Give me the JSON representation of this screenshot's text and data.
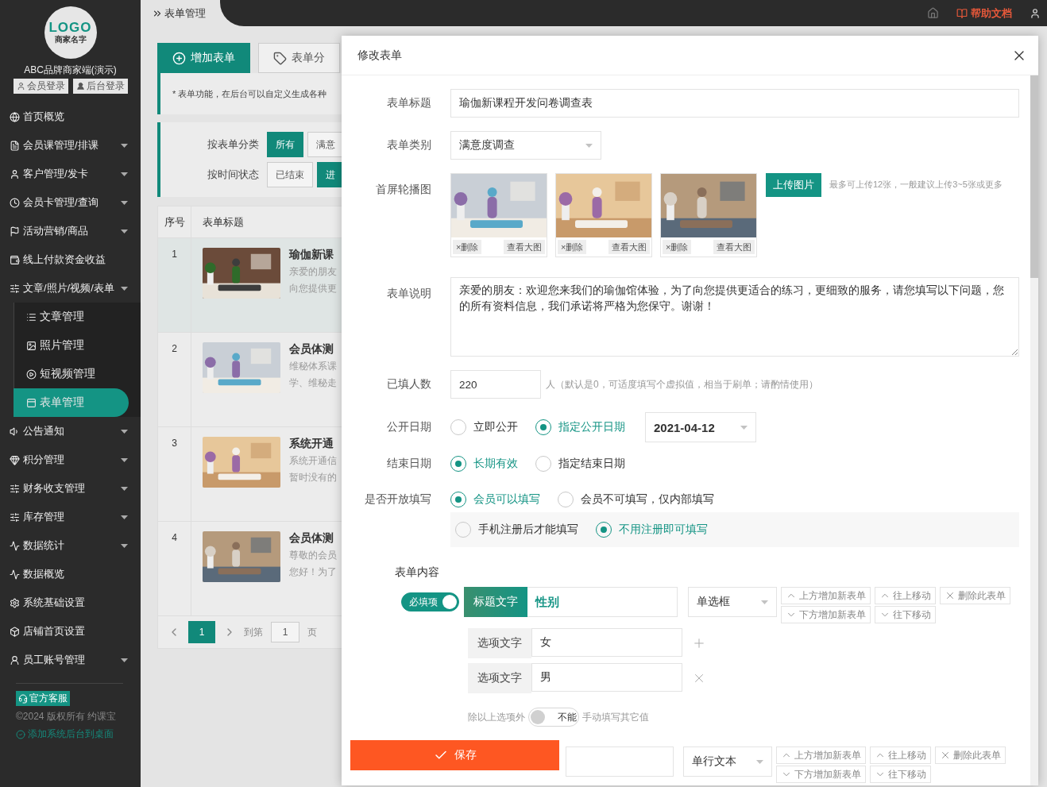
{
  "sidebar": {
    "logo": {
      "mark": "LOGO",
      "name": "商家名字"
    },
    "brand": "ABC品牌商家端(演示)",
    "login_buttons": [
      "会员登录",
      "后台登录"
    ],
    "menu": [
      {
        "label": "首页概览",
        "submenu": false
      },
      {
        "label": "会员课管理/排课",
        "submenu": true
      },
      {
        "label": "客户管理/发卡",
        "submenu": true
      },
      {
        "label": "会员卡管理/查询",
        "submenu": true
      },
      {
        "label": "活动营销/商品",
        "submenu": true
      },
      {
        "label": "线上付款资金收益",
        "submenu": false
      },
      {
        "label": "文章/照片/视频/表单",
        "submenu": true,
        "children": [
          {
            "label": "文章管理",
            "selected": false
          },
          {
            "label": "照片管理",
            "selected": false
          },
          {
            "label": "短视频管理",
            "selected": false
          },
          {
            "label": "表单管理",
            "selected": true
          }
        ]
      },
      {
        "label": "公告通知",
        "submenu": true
      },
      {
        "label": "积分管理",
        "submenu": true
      },
      {
        "label": "财务收支管理",
        "submenu": true
      },
      {
        "label": "库存管理",
        "submenu": true
      },
      {
        "label": "数据统计",
        "submenu": true
      },
      {
        "label": "数据概览",
        "submenu": false
      },
      {
        "label": "系统基础设置",
        "submenu": false
      },
      {
        "label": "店铺首页设置",
        "submenu": false
      },
      {
        "label": "员工账号管理",
        "submenu": true
      }
    ],
    "footer": {
      "service": "官方客服",
      "copyright": "©2024 版权所有 约课宝",
      "shortcut": "添加系统后台到桌面"
    }
  },
  "topbar": {
    "breadcrumb": "表单管理",
    "help": "帮助文档"
  },
  "page": {
    "actions": [
      {
        "label": "增加表单",
        "selected": true
      },
      {
        "label": "表单分",
        "selected": false
      }
    ],
    "notice": "* 表单功能，在后台可以自定义生成各种",
    "filters": [
      {
        "label": "按表单分类",
        "options": [
          {
            "label": "所有",
            "selected": true
          },
          {
            "label": "满意",
            "selected": false
          }
        ]
      },
      {
        "label": "按时间状态",
        "options": [
          {
            "label": "已结束",
            "selected": false
          },
          {
            "label": "进",
            "selected": true
          }
        ]
      }
    ],
    "table": {
      "columns": [
        "序号",
        "表单标题"
      ],
      "rows": [
        {
          "index": "1",
          "title": "瑜伽新课",
          "lines": [
            "亲爱的朋友",
            "向您提供更"
          ],
          "selected": true
        },
        {
          "index": "2",
          "title": "会员体测",
          "lines": [
            "维秘体系课",
            "学、维秘走"
          ],
          "selected": false
        },
        {
          "index": "3",
          "title": "系统开通",
          "lines": [
            "系统开通信",
            "暂时没有的"
          ],
          "selected": false
        },
        {
          "index": "4",
          "title": "会员体测",
          "lines": [
            "尊敬的会员",
            "您好！为了"
          ],
          "selected": false
        }
      ]
    },
    "pagination": {
      "page": "1",
      "goto": "到第",
      "input": "1",
      "unit": "页"
    }
  },
  "modal": {
    "title": "修改表单",
    "form_title": {
      "label": "表单标题",
      "value": "瑜伽新课程开发问卷调查表"
    },
    "category": {
      "label": "表单类别",
      "value": "满意度调查"
    },
    "carousel": {
      "label": "首屏轮播图",
      "images": [
        {
          "delete": "×删除",
          "view": "查看大图"
        },
        {
          "delete": "×删除",
          "view": "查看大图"
        },
        {
          "delete": "×删除",
          "view": "查看大图"
        }
      ],
      "upload": "上传图片",
      "hint": "最多可上传12张，一般建议上传3~5张或更多"
    },
    "description": {
      "label": "表单说明",
      "value": "亲爱的朋友：欢迎您来我们的瑜伽馆体验，为了向您提供更适合的练习，更细致的服务，请您填写以下问题，您的所有资料信息，我们承诺将严格为您保守。谢谢！"
    },
    "count": {
      "label": "已填人数",
      "value": "220",
      "hint": "人（默认是0，可适度填写个虚拟值，相当于刷单；请酌情使用）"
    },
    "publish": {
      "label": "公开日期",
      "options": [
        {
          "label": "立即公开",
          "selected": false
        },
        {
          "label": "指定公开日期",
          "selected": true
        }
      ],
      "date": "2021-04-12"
    },
    "end": {
      "label": "结束日期",
      "options": [
        {
          "label": "长期有效",
          "selected": true
        },
        {
          "label": "指定结束日期",
          "selected": false
        }
      ]
    },
    "open": {
      "label": "是否开放填写",
      "options": [
        {
          "label": "会员可以填写",
          "selected": true
        },
        {
          "label": "会员不可填写，仅内部填写",
          "selected": false
        }
      ],
      "sub_options": [
        {
          "label": "手机注册后才能填写",
          "selected": false
        },
        {
          "label": "不用注册即可填写",
          "selected": true
        }
      ]
    },
    "content_label": "表单内容",
    "fields": [
      {
        "kind": "choice",
        "required": {
          "label": "必填项",
          "on": true
        },
        "title_label": "标题文字",
        "title": "性别",
        "type": "单选框",
        "buttons": [
          "上方增加新表单",
          "往上移动",
          "删除此表单",
          "下方增加新表单",
          "往下移动"
        ],
        "options": [
          {
            "label": "选项文字",
            "value": "女"
          },
          {
            "label": "选项文字",
            "value": "男"
          }
        ],
        "other": {
          "before": "除以上选项外",
          "toggle": "不能",
          "on": false,
          "after": "手动填写其它值"
        }
      },
      {
        "kind": "text",
        "type": "单行文本",
        "buttons": [
          "上方增加新表单",
          "往上移动",
          "删除此表单",
          "下方增加新表单",
          "往下移动"
        ]
      }
    ],
    "save": "保存"
  }
}
